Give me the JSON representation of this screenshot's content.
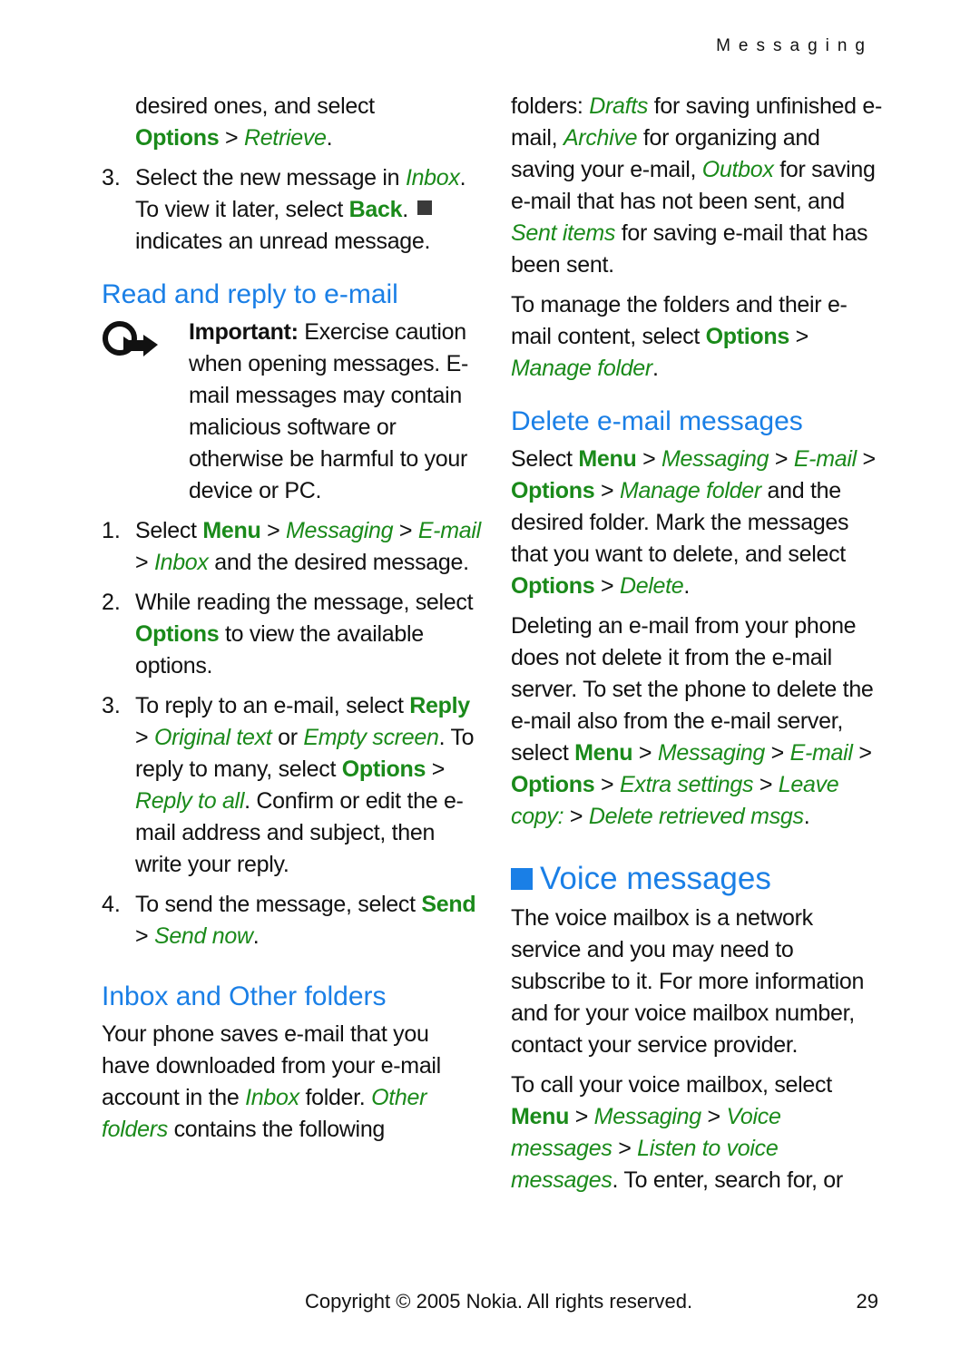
{
  "header": {
    "running_head": "Messaging"
  },
  "colors": {
    "heading": "#1a7fe6",
    "ui_term": "#1a8a1a",
    "text": "#111111"
  },
  "left": {
    "cont": {
      "t1": "desired ones, and select",
      "opt": "Options",
      "sep": " > ",
      "retrieve": "Retrieve",
      "dot": "."
    },
    "step3": {
      "num": "3.",
      "t1": "Select the new message in ",
      "inbox": "Inbox",
      "t2": ". To view it later, select ",
      "back": "Back",
      "t3": ".",
      "t4": " indicates an unread message.",
      "icon": "unread-message-square-icon"
    },
    "read_heading": "Read and reply to e-mail",
    "important": {
      "icon": "important-note-icon",
      "label": "Important:",
      "text": " Exercise caution when opening messages. E-mail messages may contain malicious software or otherwise be harmful to your device or PC."
    },
    "steps": [
      {
        "num": "1.",
        "a": "Select ",
        "menu": "Menu",
        "s1": " > ",
        "messaging": "Messaging",
        "s2": " > ",
        "email": "E-mail",
        "s3": " > ",
        "inbox": "Inbox",
        "b": " and the desired message."
      },
      {
        "num": "2.",
        "a": "While reading the message, select ",
        "options": "Options",
        "b": " to view the available options."
      },
      {
        "num": "3.",
        "a": "To reply to an e-mail, select ",
        "reply": "Reply",
        "s1": " > ",
        "orig": "Original text",
        "or": " or ",
        "empty": "Empty screen",
        "b": ". To reply to many, select ",
        "options": "Options",
        "s2": " > ",
        "replyall": "Reply to all",
        "c": ". Confirm or edit the e-mail address and subject, then write your reply."
      },
      {
        "num": "4.",
        "a": "To send the message, select ",
        "send": "Send",
        "s1": " > ",
        "sendnow": "Send now",
        "b": "."
      }
    ],
    "inbox_heading": "Inbox and Other folders",
    "inbox_para": {
      "a": "Your phone saves e-mail that you have downloaded from your e-mail account in the ",
      "inbox": "Inbox",
      "b": " folder. ",
      "other": "Other folders",
      "c": " contains the following"
    }
  },
  "right": {
    "folders_para": {
      "a": "folders: ",
      "drafts": "Drafts",
      "b": " for saving unfinished e-mail, ",
      "archive": "Archive",
      "c": " for organizing and saving your e-mail, ",
      "outbox": "Outbox",
      "d": " for saving e-mail that has not been sent, and ",
      "sent": "Sent items",
      "e": " for saving e-mail that has been sent."
    },
    "manage_para": {
      "a": "To manage the folders and their e-mail content, select ",
      "options": "Options",
      "s1": " > ",
      "manage": "Manage folder",
      "b": "."
    },
    "delete_heading": "Delete e-mail messages",
    "delete_para": {
      "a": "Select ",
      "menu": "Menu",
      "s1": " > ",
      "messaging": "Messaging",
      "s2": " > ",
      "email": "E-mail",
      "s3": " > ",
      "options": "Options",
      "s4": " > ",
      "manage": "Manage folder",
      "b": " and the desired folder. Mark the messages that you want to delete, and select ",
      "options2": "Options",
      "s5": " > ",
      "delete": "Delete",
      "c": "."
    },
    "server_para": {
      "a": "Deleting an e-mail from your phone does not delete it from the e-mail server. To set the phone to delete the e-mail also from the e-mail server, select ",
      "menu": "Menu",
      "s1": " > ",
      "messaging": "Messaging",
      "s2": " > ",
      "email": "E-mail",
      "s3": " > ",
      "options": "Options",
      "s4": " > ",
      "extra": "Extra settings",
      "s5": " > ",
      "leave": "Leave copy:",
      "s6": "  > ",
      "delret": "Delete retrieved msgs",
      "b": "."
    },
    "voice_heading": "Voice messages",
    "voice_para1": "The voice mailbox is a network service and you may need to subscribe to it. For more information and for your voice mailbox number, contact your service provider.",
    "voice_para2": {
      "a": "To call your voice mailbox, select ",
      "menu": "Menu",
      "s1": " > ",
      "messaging": "Messaging",
      "s2": " > ",
      "voice": "Voice messages",
      "s3": " > ",
      "listen": "Listen to voice messages",
      "b": ". To enter, search for, or"
    }
  },
  "footer": {
    "copyright": "Copyright © 2005 Nokia. All rights reserved.",
    "page_number": "29"
  }
}
